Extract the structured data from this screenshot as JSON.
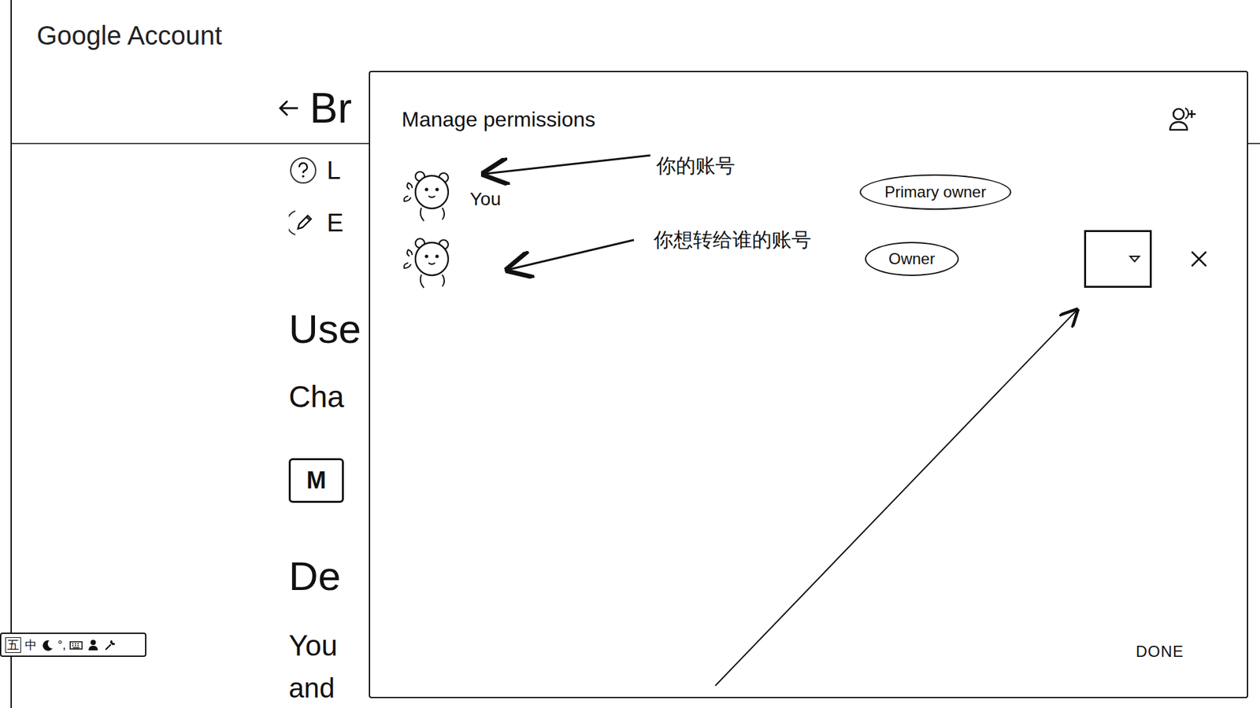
{
  "page": {
    "logo": "Google Account",
    "title": "Br",
    "items": [
      {
        "label": "L",
        "kind": "help"
      },
      {
        "label": "E",
        "kind": "edit"
      }
    ],
    "sections": [
      {
        "heading": "Use",
        "text": "Cha",
        "button": "M"
      },
      {
        "heading": "De",
        "lines": [
          "You",
          "and"
        ]
      }
    ]
  },
  "dialog": {
    "title": "Manage permissions",
    "members": [
      {
        "name": "You",
        "role": "Primary owner",
        "kind": "primary",
        "annotation": "你的账号"
      },
      {
        "role": "Owner",
        "kind": "removable",
        "annotation": "你想转给谁的账号"
      }
    ],
    "done": "DONE"
  },
  "ime_toolbar": {
    "mode": "五",
    "lang": "中",
    "punct": "°,"
  }
}
